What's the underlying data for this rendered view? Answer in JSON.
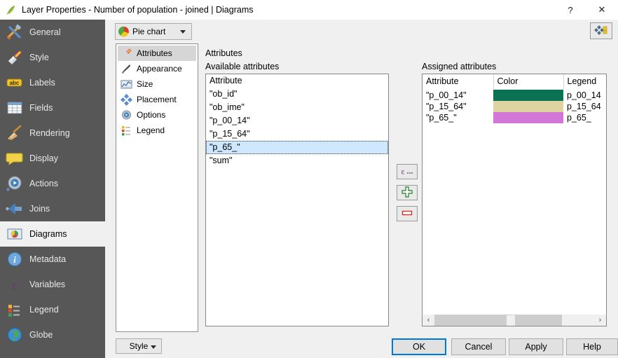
{
  "window": {
    "title": "Layer Properties - Number of population - joined | Diagrams",
    "icon": "qgis-logo-icon",
    "help_label": "?",
    "close_label": "✕"
  },
  "sidebar": {
    "items": [
      {
        "label": "General",
        "icon": "hammer-wrench-icon",
        "selected": false
      },
      {
        "label": "Style",
        "icon": "paintbrush-icon",
        "selected": false
      },
      {
        "label": "Labels",
        "icon": "abc-label-icon",
        "selected": false
      },
      {
        "label": "Fields",
        "icon": "table-grid-icon",
        "selected": false
      },
      {
        "label": "Rendering",
        "icon": "broom-icon",
        "selected": false
      },
      {
        "label": "Display",
        "icon": "speech-bubble-icon",
        "selected": false
      },
      {
        "label": "Actions",
        "icon": "gear-play-icon",
        "selected": false
      },
      {
        "label": "Joins",
        "icon": "left-arrow-join-icon",
        "selected": false
      },
      {
        "label": "Diagrams",
        "icon": "diagram-chart-icon",
        "selected": true
      },
      {
        "label": "Metadata",
        "icon": "info-circle-icon",
        "selected": false
      },
      {
        "label": "Variables",
        "icon": "epsilon-icon",
        "selected": false
      },
      {
        "label": "Legend",
        "icon": "legend-list-icon",
        "selected": false
      },
      {
        "label": "Globe",
        "icon": "globe-icon",
        "selected": false
      }
    ]
  },
  "toolbar": {
    "diagram_type": "Pie chart",
    "diagram_type_icon": "pie-chart-icon",
    "data_defined_icon": "data-defined-override-icon"
  },
  "inner_tabs": {
    "items": [
      {
        "label": "Attributes",
        "icon": "paintbrush-icon",
        "selected": true
      },
      {
        "label": "Appearance",
        "icon": "brush-icon",
        "selected": false
      },
      {
        "label": "Size",
        "icon": "chart-size-icon",
        "selected": false
      },
      {
        "label": "Placement",
        "icon": "placement-icon",
        "selected": false
      },
      {
        "label": "Options",
        "icon": "gear-play-icon",
        "selected": false
      },
      {
        "label": "Legend",
        "icon": "legend-list-icon",
        "selected": false
      }
    ]
  },
  "main": {
    "section_title": "Attributes",
    "available": {
      "label": "Available attributes",
      "column_header": "Attribute",
      "rows": [
        {
          "value": "\"ob_id\"",
          "selected": false
        },
        {
          "value": "\"ob_ime\"",
          "selected": false
        },
        {
          "value": "\"p_00_14\"",
          "selected": false
        },
        {
          "value": "\"p_15_64\"",
          "selected": false
        },
        {
          "value": "\"p_65_\"",
          "selected": true
        },
        {
          "value": "\"sum\"",
          "selected": false
        }
      ]
    },
    "action_buttons": [
      {
        "name": "expression-button",
        "label": "ε...",
        "icon": "epsilon-expression-icon"
      },
      {
        "name": "add-button",
        "label": "+",
        "icon": "green-plus-icon"
      },
      {
        "name": "remove-button",
        "label": "−",
        "icon": "red-minus-icon"
      }
    ],
    "assigned": {
      "label": "Assigned attributes",
      "columns": [
        "Attribute",
        "Color",
        "Legend"
      ],
      "rows": [
        {
          "attribute": "\"p_00_14\"",
          "color": "#0b7253",
          "legend": "p_00_14"
        },
        {
          "attribute": "\"p_15_64\"",
          "color": "#ddd4a1",
          "legend": "p_15_64"
        },
        {
          "attribute": "\"p_65_\"",
          "color": "#d276d8",
          "legend": "p_65_"
        }
      ],
      "scroll_left_label": "‹",
      "scroll_right_label": "›"
    }
  },
  "footer": {
    "style_label": "Style",
    "ok_label": "OK",
    "cancel_label": "Cancel",
    "apply_label": "Apply",
    "help_label": "Help"
  }
}
